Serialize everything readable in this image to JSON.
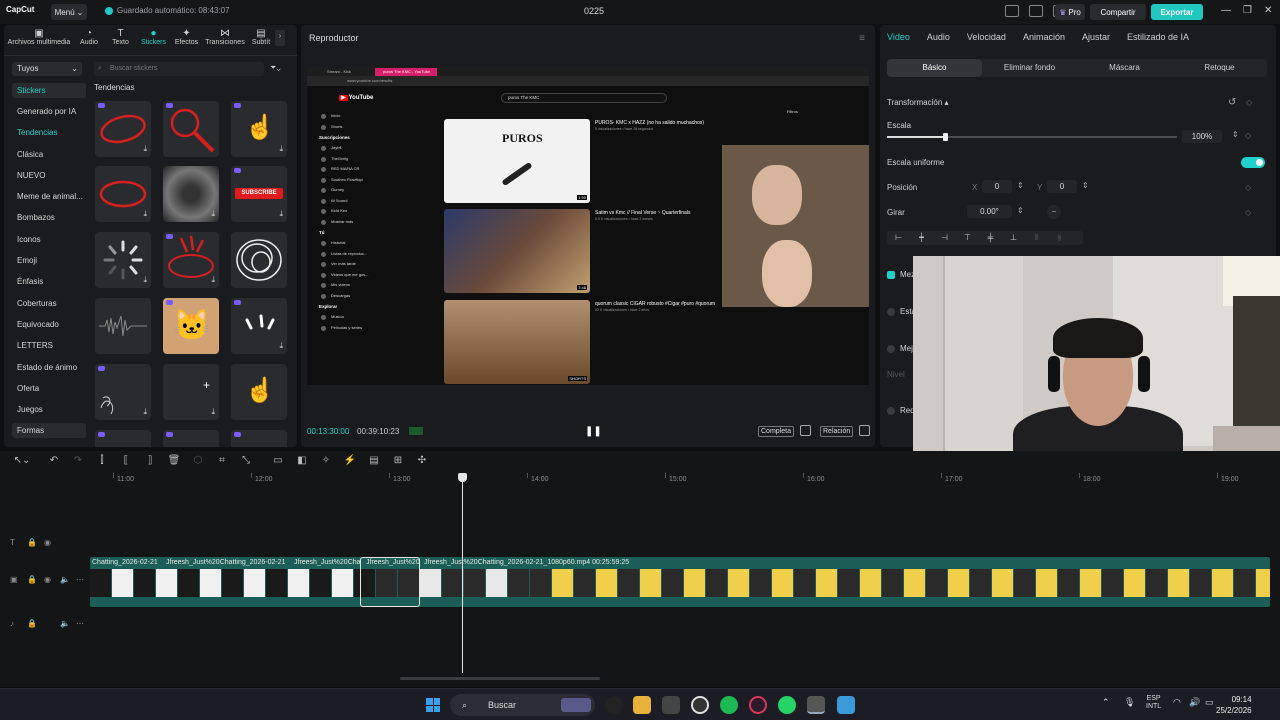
{
  "titlebar": {
    "logo": "CapCut",
    "menu_label": "Menú",
    "autosave_text": "Guardado automático: 08:43:07",
    "project_title": "0225",
    "pro_label": "Pro",
    "share_label": "Compartir",
    "export_label": "Exportar"
  },
  "left_panel": {
    "tabs": [
      {
        "label": "Archivos multimedia",
        "icon": "media-icon"
      },
      {
        "label": "Audio",
        "icon": "audio-icon"
      },
      {
        "label": "Texto",
        "icon": "text-icon"
      },
      {
        "label": "Stickers",
        "icon": "stickers-icon"
      },
      {
        "label": "Efectos",
        "icon": "effects-icon"
      },
      {
        "label": "Transiciones",
        "icon": "transitions-icon"
      },
      {
        "label": "Subtít",
        "icon": "subtitles-icon"
      }
    ],
    "category_select": "Tuyos",
    "search_placeholder": "Buscar stickers",
    "section_title": "Tendencias",
    "side_items": [
      "Stickers",
      "Generado por IA",
      "Tendencias",
      "Clásica",
      "NUEVO",
      "Meme de animal...",
      "Bombazos",
      "Iconos",
      "Emoji",
      "Énfasis",
      "Coberturas",
      "Equivocado",
      "LETTERS",
      "Estado de ánimo",
      "Oferta",
      "Juegos",
      "Formas"
    ],
    "sticker_subscribe_text": "SUBSCRIBE"
  },
  "player": {
    "title": "Reproductor",
    "current_time": "00:13:30:00",
    "total_time": "00:39:10:23",
    "full_label": "Completa",
    "ratio_label": "Relación",
    "youtube": {
      "tab1": "Stream - Kick Dashboard",
      "tab2": "puros The KMC - YouTube",
      "url": "www.youtube.com/results",
      "search_query": "puros The KMC",
      "filters_label": "Filtros",
      "sidebar_top": [
        "Inicio",
        "Shorts"
      ],
      "subs_header": "Suscripciones",
      "subs": [
        "Jayb€",
        "TheGrefg",
        "RED MAFIA CR",
        "Southeo Flowflopi",
        "Gurney",
        "W Sound",
        "Kidd Keo",
        "Mostrar más"
      ],
      "you_header": "Tú",
      "you_items": [
        "Historial",
        "Listas de reproduc...",
        "Ver más tarde",
        "Videos que me gus...",
        "Mis videos",
        "Descargas"
      ],
      "explore_header": "Explorar",
      "explore_items": [
        "Música",
        "Películas y series"
      ],
      "results": [
        {
          "title": "PUROS- KMC x HAZZ (no ha salido muchachos)",
          "meta": "5 visualizaciones • hace 26 segundos",
          "thumb_text": "PUROS",
          "duration": "1:50"
        },
        {
          "title": "Satim vs Kmc // Final Verse ~ Quarterfinals",
          "meta": "9.5 K visualizaciones • hace 2 meses",
          "duration": "7:46"
        },
        {
          "title": "quorum classic CIGAR robusto #Cigar #puro #quorum",
          "meta": "22 K visualizaciones • hace 2 años",
          "duration": "SHORTS"
        }
      ]
    }
  },
  "right_panel": {
    "tabs": [
      "Video",
      "Audio",
      "Velocidad",
      "Animación",
      "Ajustar",
      "Estilizado de IA"
    ],
    "subtabs": [
      "Básico",
      "Eliminar fondo",
      "Máscara",
      "Retoque"
    ],
    "section_transform": "Transformación",
    "scale_label": "Escala",
    "scale_value": "100%",
    "scale_fraction": 0.2,
    "uniform_scale_label": "Escala uniforme",
    "position_label": "Posición",
    "pos_x_label": "X",
    "pos_x": "0",
    "pos_y_label": "Y",
    "pos_y": "0",
    "rotate_label": "Girar",
    "rotate_value": "0.00°",
    "partial_labels": [
      "Mez",
      "Esta",
      "Mejo",
      "Nivel",
      "Red"
    ]
  },
  "timeline": {
    "ticks": [
      "11:00",
      "12:00",
      "13:00",
      "14:00",
      "15:00",
      "16:00",
      "17:00",
      "18:00",
      "19:00"
    ],
    "clip_labels": [
      "Chatting_2026-02-21",
      "Jfreesh_Just%20Chatting_2026-02-21",
      "Jfreesh_Just%20Cha",
      "Jfreesh_Just%20",
      "Jfreesh_Just%20Chatting_2026-02-21_1080p60.mp4  00:25:59:25"
    ]
  },
  "taskbar": {
    "search_label": "Buscar",
    "lang_top": "ESP",
    "lang_bottom": "INTL",
    "time": "09:14",
    "date": "25/2/2026"
  },
  "colors": {
    "accent": "#1fd1c9",
    "export": "#1fc7c0",
    "track": "#1a5e57"
  }
}
